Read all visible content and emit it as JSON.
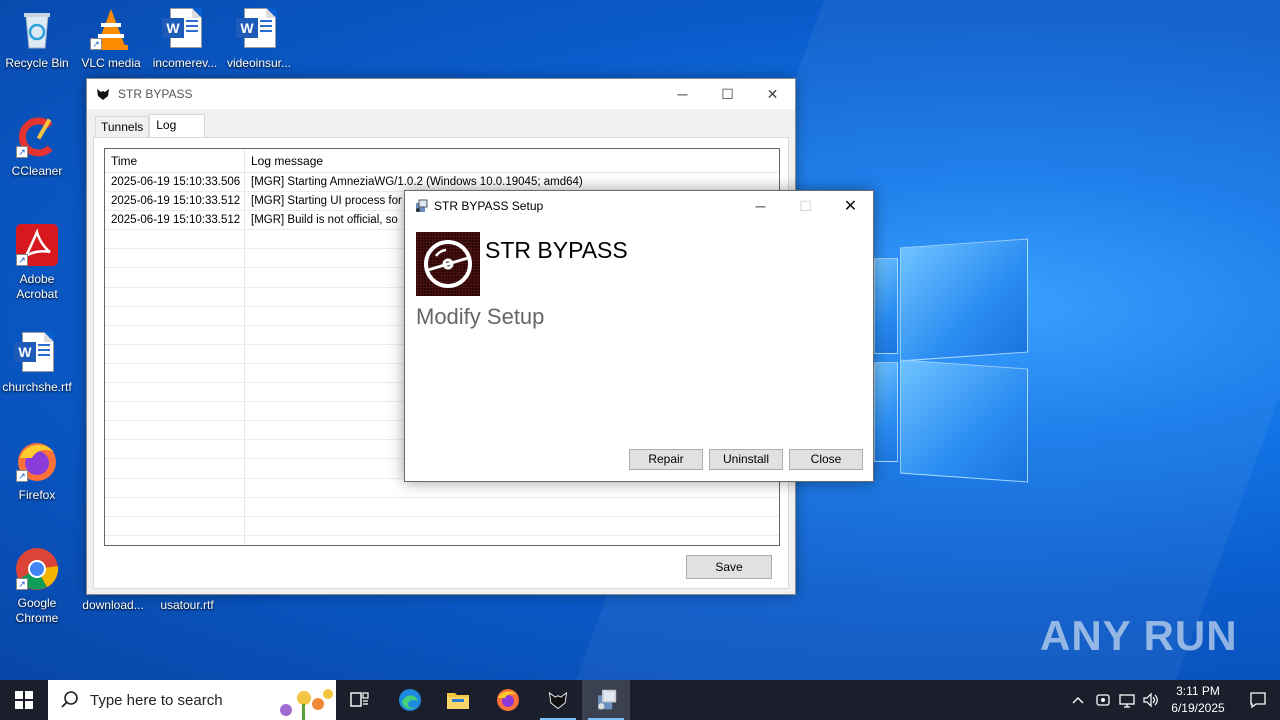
{
  "desktop": {
    "icons": [
      {
        "label": "Recycle Bin"
      },
      {
        "label": "VLC media"
      },
      {
        "label": "incomerev..."
      },
      {
        "label": "videoinsur..."
      },
      {
        "label": "CCleaner"
      },
      {
        "label": "Adobe Acrobat"
      },
      {
        "label": "churchshe.rtf"
      },
      {
        "label": "Firefox"
      },
      {
        "label": "Google Chrome"
      },
      {
        "label": "download..."
      },
      {
        "label": "usatour.rtf"
      }
    ],
    "watermark": "ANY RUN"
  },
  "main_window": {
    "title": "STR BYPASS",
    "tabs": [
      {
        "label": "Tunnels"
      },
      {
        "label": "Log"
      }
    ],
    "active_tab": "Log",
    "log": {
      "columns": [
        "Time",
        "Log message"
      ],
      "rows": [
        {
          "time": "2025-06-19 15:10:33.506",
          "message": "[MGR] Starting AmneziaWG/1.0.2 (Windows 10.0.19045; amd64)"
        },
        {
          "time": "2025-06-19 15:10:33.512",
          "message": "[MGR] Starting UI process for"
        },
        {
          "time": "2025-06-19 15:10:33.512",
          "message": "[MGR] Build is not official, so"
        }
      ]
    },
    "save_label": "Save"
  },
  "setup_dialog": {
    "title": "STR BYPASS Setup",
    "product_name": "STR BYPASS",
    "subtitle": "Modify Setup",
    "buttons": {
      "repair": "Repair",
      "uninstall": "Uninstall",
      "close": "Close"
    }
  },
  "taskbar": {
    "search_placeholder": "Type here to search",
    "time": "3:11 PM",
    "date": "6/19/2025"
  },
  "colors": {
    "desktop_blue": "#0a5fd0",
    "taskbar": "#1a1f2b",
    "button_face": "#e1e1e1"
  }
}
